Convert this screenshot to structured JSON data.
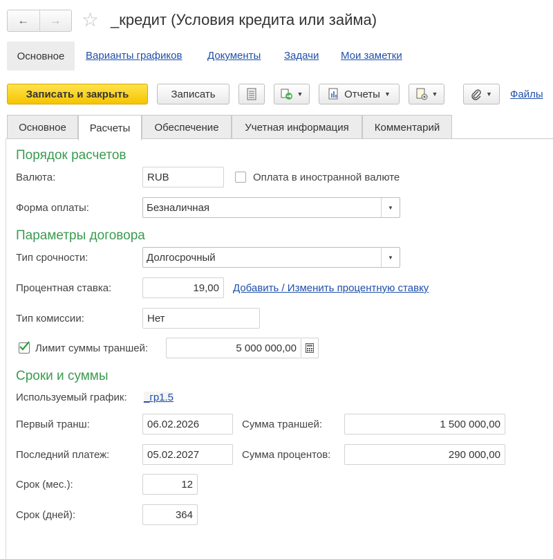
{
  "header": {
    "title": "_кредит (Условия кредита или займа)",
    "back_icon": "←",
    "forward_icon": "→",
    "star_icon": "☆"
  },
  "topnav": {
    "items": [
      "Основное",
      "Варианты графиков",
      "Документы",
      "Задачи",
      "Мои заметки"
    ]
  },
  "toolbar": {
    "save_close_label": "Записать и закрыть",
    "save_label": "Записать",
    "reports_label": "Отчеты",
    "files_label": "Файлы"
  },
  "tabs": [
    "Основное",
    "Расчеты",
    "Обеспечение",
    "Учетная информация",
    "Комментарий"
  ],
  "active_tab": "Расчеты",
  "payment": {
    "section_title": "Порядок расчетов",
    "currency_label": "Валюта:",
    "currency_value": "RUB",
    "foreign_currency_label": "Оплата в иностранной валюте",
    "foreign_currency_checked": false,
    "payment_form_label": "Форма оплаты:",
    "payment_form_value": "Безналичная"
  },
  "contract": {
    "section_title": "Параметры договора",
    "term_type_label": "Тип срочности:",
    "term_type_value": "Долгосрочный",
    "rate_label": "Процентная ставка:",
    "rate_value": "19,00",
    "rate_link": "Добавить / Изменить процентную ставку",
    "commission_label": "Тип комиссии:",
    "commission_value": "Нет",
    "limit_label": "Лимит суммы траншей:",
    "limit_checked": true,
    "limit_value": "5 000 000,00"
  },
  "terms": {
    "section_title": "Сроки и суммы",
    "schedule_label": "Используемый график:",
    "schedule_link": "_гр1.5",
    "first_tranche_label": "Первый транш:",
    "first_tranche_value": "06.02.2026",
    "tranches_sum_label": "Сумма траншей:",
    "tranches_sum_value": "1 500 000,00",
    "last_payment_label": "Последний платеж:",
    "last_payment_value": "05.02.2027",
    "interest_sum_label": "Сумма процентов:",
    "interest_sum_value": "290 000,00",
    "months_label": "Срок (мес.):",
    "months_value": "12",
    "days_label": "Срок (дней):",
    "days_value": "364"
  },
  "colors": {
    "section_green": "#3a9b4f",
    "link_blue": "#1f4fa8",
    "primary_yellow": "#f5c400"
  }
}
